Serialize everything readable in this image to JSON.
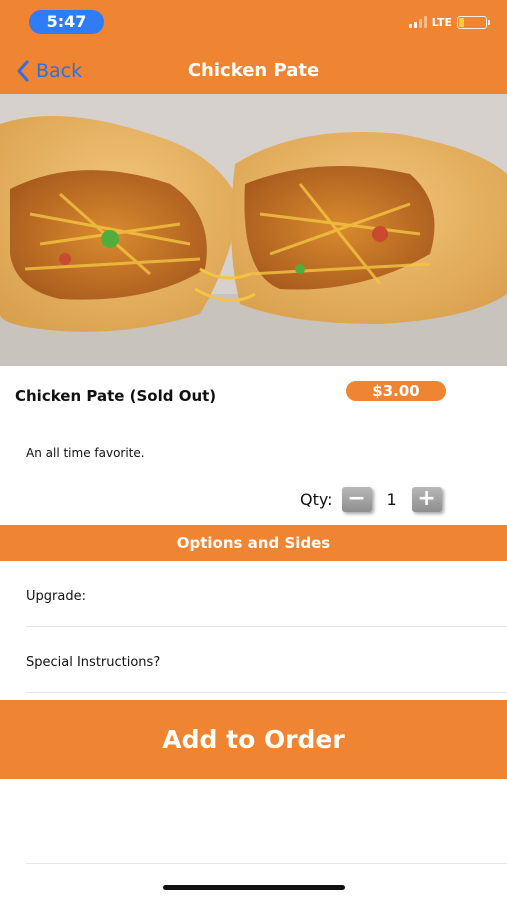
{
  "status_bar": {
    "time": "5:47",
    "network": "LTE",
    "battery_level": 0.18,
    "battery_color": "#f6d23f"
  },
  "nav": {
    "back_label": "Back",
    "title": "Chicken Pate"
  },
  "hero": {
    "alt": "chicken-pate-photo"
  },
  "product": {
    "name": "Chicken Pate (Sold Out)",
    "price": "$3.00",
    "description": "An all time favorite."
  },
  "quantity": {
    "label": "Qty:",
    "value": "1",
    "decrement_symbol": "−",
    "increment_symbol": "+"
  },
  "options": {
    "section_title": "Options and Sides",
    "rows": [
      {
        "label": "Upgrade:"
      },
      {
        "label": "Special Instructions?"
      }
    ]
  },
  "actions": {
    "add_to_order": "Add to Order"
  },
  "colors": {
    "accent": "#ef8432",
    "link": "#2f6fe0",
    "time_pill": "#2f7cf6"
  }
}
